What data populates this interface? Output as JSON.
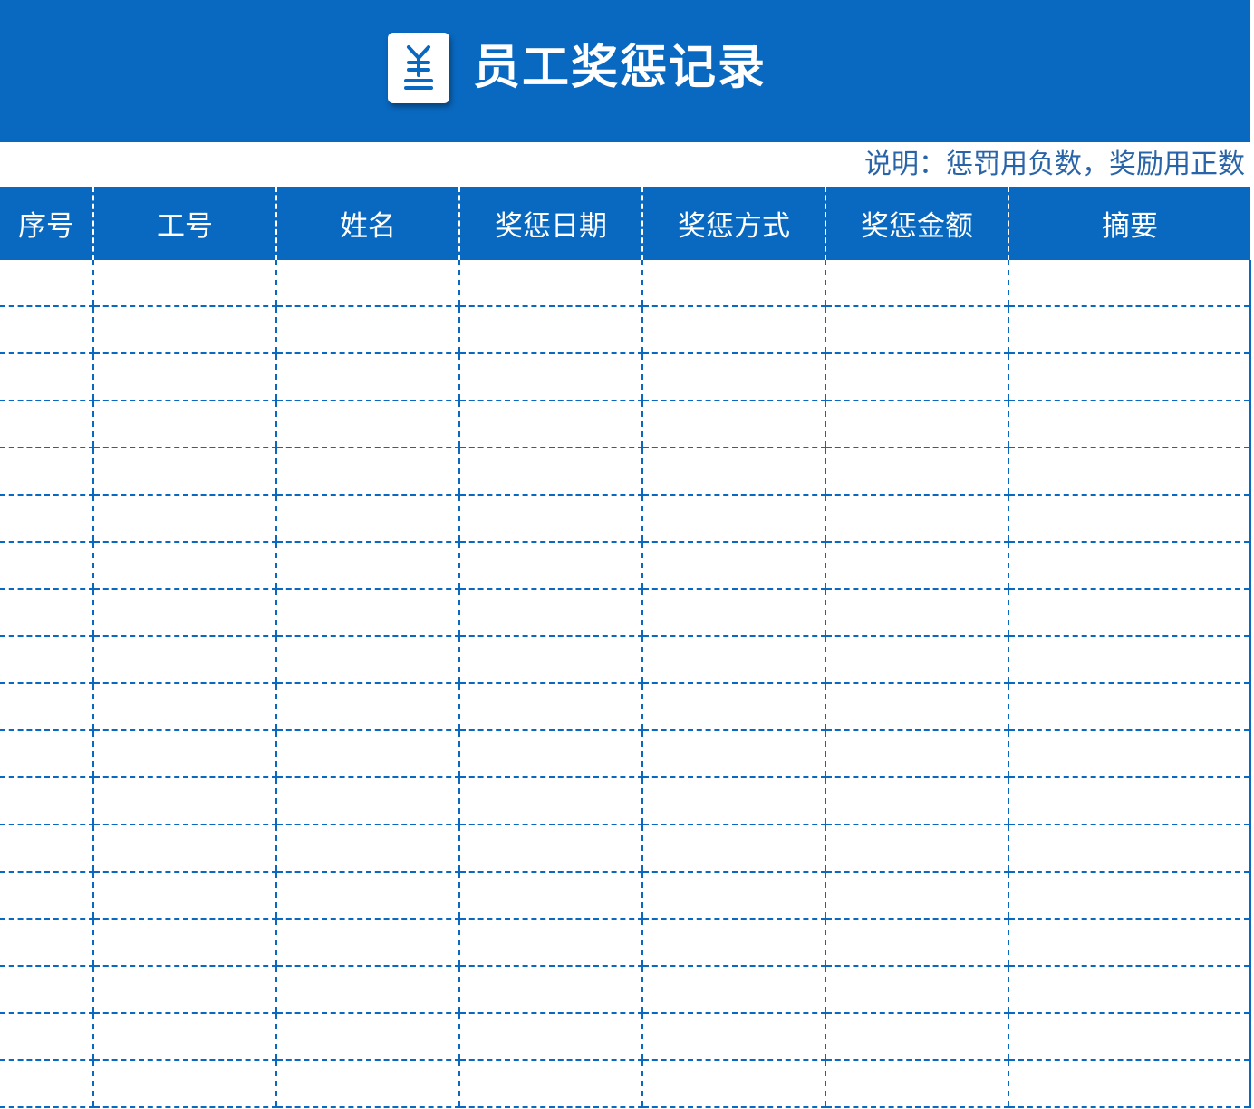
{
  "header": {
    "title": "员工奖惩记录",
    "icon": "yen-document-icon",
    "background_color": "#0968bf"
  },
  "note": "说明：惩罚用负数，奖励用正数",
  "table": {
    "columns": [
      "序号",
      "工号",
      "姓名",
      "奖惩日期",
      "奖惩方式",
      "奖惩金额",
      "摘要"
    ],
    "rows": [
      [
        "",
        "",
        "",
        "",
        "",
        "",
        ""
      ],
      [
        "",
        "",
        "",
        "",
        "",
        "",
        ""
      ],
      [
        "",
        "",
        "",
        "",
        "",
        "",
        ""
      ],
      [
        "",
        "",
        "",
        "",
        "",
        "",
        ""
      ],
      [
        "",
        "",
        "",
        "",
        "",
        "",
        ""
      ],
      [
        "",
        "",
        "",
        "",
        "",
        "",
        ""
      ],
      [
        "",
        "",
        "",
        "",
        "",
        "",
        ""
      ],
      [
        "",
        "",
        "",
        "",
        "",
        "",
        ""
      ],
      [
        "",
        "",
        "",
        "",
        "",
        "",
        ""
      ],
      [
        "",
        "",
        "",
        "",
        "",
        "",
        ""
      ],
      [
        "",
        "",
        "",
        "",
        "",
        "",
        ""
      ],
      [
        "",
        "",
        "",
        "",
        "",
        "",
        ""
      ],
      [
        "",
        "",
        "",
        "",
        "",
        "",
        ""
      ],
      [
        "",
        "",
        "",
        "",
        "",
        "",
        ""
      ],
      [
        "",
        "",
        "",
        "",
        "",
        "",
        ""
      ],
      [
        "",
        "",
        "",
        "",
        "",
        "",
        ""
      ],
      [
        "",
        "",
        "",
        "",
        "",
        "",
        ""
      ],
      [
        "",
        "",
        "",
        "",
        "",
        "",
        ""
      ]
    ]
  },
  "colors": {
    "accent": "#0968bf",
    "note_text": "#2a64a8"
  }
}
